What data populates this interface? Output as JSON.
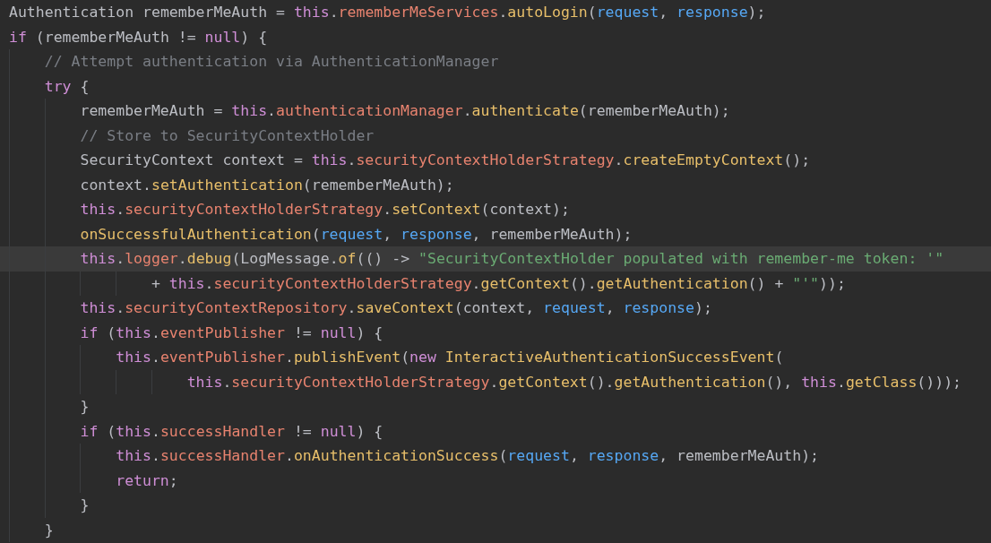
{
  "editor": {
    "lines": [
      {
        "current": false,
        "tokens": [
          {
            "text": "Authentication rememberMeAuth = ",
            "kind": "plain"
          },
          {
            "text": "this",
            "kind": "keyword"
          },
          {
            "text": ".",
            "kind": "plain"
          },
          {
            "text": "rememberMeServices",
            "kind": "field"
          },
          {
            "text": ".",
            "kind": "plain"
          },
          {
            "text": "autoLogin",
            "kind": "method"
          },
          {
            "text": "(",
            "kind": "plain"
          },
          {
            "text": "request",
            "kind": "param"
          },
          {
            "text": ", ",
            "kind": "plain"
          },
          {
            "text": "response",
            "kind": "param"
          },
          {
            "text": ");",
            "kind": "plain"
          }
        ]
      },
      {
        "current": false,
        "tokens": [
          {
            "text": "if",
            "kind": "keyword"
          },
          {
            "text": " (rememberMeAuth != ",
            "kind": "plain"
          },
          {
            "text": "null",
            "kind": "keyword"
          },
          {
            "text": ") {",
            "kind": "plain"
          }
        ]
      },
      {
        "current": false,
        "tokens": [
          {
            "text": "    // Attempt authentication via AuthenticationManager",
            "kind": "comment"
          }
        ]
      },
      {
        "current": false,
        "tokens": [
          {
            "text": "    try",
            "kind": "keyword"
          },
          {
            "text": " {",
            "kind": "plain"
          }
        ]
      },
      {
        "current": false,
        "tokens": [
          {
            "text": "        rememberMeAuth = ",
            "kind": "plain"
          },
          {
            "text": "this",
            "kind": "keyword"
          },
          {
            "text": ".",
            "kind": "plain"
          },
          {
            "text": "authenticationManager",
            "kind": "field"
          },
          {
            "text": ".",
            "kind": "plain"
          },
          {
            "text": "authenticate",
            "kind": "method"
          },
          {
            "text": "(rememberMeAuth);",
            "kind": "plain"
          }
        ]
      },
      {
        "current": false,
        "tokens": [
          {
            "text": "        // Store to SecurityContextHolder",
            "kind": "comment"
          }
        ]
      },
      {
        "current": false,
        "tokens": [
          {
            "text": "        SecurityContext context = ",
            "kind": "plain"
          },
          {
            "text": "this",
            "kind": "keyword"
          },
          {
            "text": ".",
            "kind": "plain"
          },
          {
            "text": "securityContextHolderStrategy",
            "kind": "field"
          },
          {
            "text": ".",
            "kind": "plain"
          },
          {
            "text": "createEmptyContext",
            "kind": "method"
          },
          {
            "text": "();",
            "kind": "plain"
          }
        ]
      },
      {
        "current": false,
        "tokens": [
          {
            "text": "        context.",
            "kind": "plain"
          },
          {
            "text": "setAuthentication",
            "kind": "method"
          },
          {
            "text": "(rememberMeAuth);",
            "kind": "plain"
          }
        ]
      },
      {
        "current": false,
        "tokens": [
          {
            "text": "        this",
            "kind": "keyword"
          },
          {
            "text": ".",
            "kind": "plain"
          },
          {
            "text": "securityContextHolderStrategy",
            "kind": "field"
          },
          {
            "text": ".",
            "kind": "plain"
          },
          {
            "text": "setContext",
            "kind": "method"
          },
          {
            "text": "(context);",
            "kind": "plain"
          }
        ]
      },
      {
        "current": false,
        "tokens": [
          {
            "text": "        onSuccessfulAuthentication",
            "kind": "method"
          },
          {
            "text": "(",
            "kind": "plain"
          },
          {
            "text": "request",
            "kind": "param"
          },
          {
            "text": ", ",
            "kind": "plain"
          },
          {
            "text": "response",
            "kind": "param"
          },
          {
            "text": ", rememberMeAuth);",
            "kind": "plain"
          }
        ]
      },
      {
        "current": true,
        "tokens": [
          {
            "text": "        this",
            "kind": "keyword"
          },
          {
            "text": ".",
            "kind": "plain"
          },
          {
            "text": "logger",
            "kind": "field"
          },
          {
            "text": ".",
            "kind": "plain"
          },
          {
            "text": "debug",
            "kind": "method"
          },
          {
            "text": "(LogMessage.",
            "kind": "plain"
          },
          {
            "text": "of",
            "kind": "method"
          },
          {
            "text": "(() -> ",
            "kind": "plain"
          },
          {
            "text": "\"SecurityContextHolder populated with remember-me token: '\"",
            "kind": "string"
          }
        ]
      },
      {
        "current": false,
        "tokens": [
          {
            "text": "                + ",
            "kind": "plain"
          },
          {
            "text": "this",
            "kind": "keyword"
          },
          {
            "text": ".",
            "kind": "plain"
          },
          {
            "text": "securityContextHolderStrategy",
            "kind": "field"
          },
          {
            "text": ".",
            "kind": "plain"
          },
          {
            "text": "getContext",
            "kind": "method"
          },
          {
            "text": "().",
            "kind": "plain"
          },
          {
            "text": "getAuthentication",
            "kind": "method"
          },
          {
            "text": "() + ",
            "kind": "plain"
          },
          {
            "text": "\"'\"",
            "kind": "string"
          },
          {
            "text": "));",
            "kind": "plain"
          }
        ]
      },
      {
        "current": false,
        "tokens": [
          {
            "text": "        this",
            "kind": "keyword"
          },
          {
            "text": ".",
            "kind": "plain"
          },
          {
            "text": "securityContextRepository",
            "kind": "field"
          },
          {
            "text": ".",
            "kind": "plain"
          },
          {
            "text": "saveContext",
            "kind": "method"
          },
          {
            "text": "(context, ",
            "kind": "plain"
          },
          {
            "text": "request",
            "kind": "param"
          },
          {
            "text": ", ",
            "kind": "plain"
          },
          {
            "text": "response",
            "kind": "param"
          },
          {
            "text": ");",
            "kind": "plain"
          }
        ]
      },
      {
        "current": false,
        "tokens": [
          {
            "text": "        if",
            "kind": "keyword"
          },
          {
            "text": " (",
            "kind": "plain"
          },
          {
            "text": "this",
            "kind": "keyword"
          },
          {
            "text": ".",
            "kind": "plain"
          },
          {
            "text": "eventPublisher",
            "kind": "field"
          },
          {
            "text": " != ",
            "kind": "plain"
          },
          {
            "text": "null",
            "kind": "keyword"
          },
          {
            "text": ") {",
            "kind": "plain"
          }
        ]
      },
      {
        "current": false,
        "tokens": [
          {
            "text": "            this",
            "kind": "keyword"
          },
          {
            "text": ".",
            "kind": "plain"
          },
          {
            "text": "eventPublisher",
            "kind": "field"
          },
          {
            "text": ".",
            "kind": "plain"
          },
          {
            "text": "publishEvent",
            "kind": "method"
          },
          {
            "text": "(",
            "kind": "plain"
          },
          {
            "text": "new",
            "kind": "keyword"
          },
          {
            "text": " InteractiveAuthenticationSuccessEvent",
            "kind": "method"
          },
          {
            "text": "(",
            "kind": "plain"
          }
        ]
      },
      {
        "current": false,
        "tokens": [
          {
            "text": "                    this",
            "kind": "keyword"
          },
          {
            "text": ".",
            "kind": "plain"
          },
          {
            "text": "securityContextHolderStrategy",
            "kind": "field"
          },
          {
            "text": ".",
            "kind": "plain"
          },
          {
            "text": "getContext",
            "kind": "method"
          },
          {
            "text": "().",
            "kind": "plain"
          },
          {
            "text": "getAuthentication",
            "kind": "method"
          },
          {
            "text": "(), ",
            "kind": "plain"
          },
          {
            "text": "this",
            "kind": "keyword"
          },
          {
            "text": ".",
            "kind": "plain"
          },
          {
            "text": "getClass",
            "kind": "method"
          },
          {
            "text": "()));",
            "kind": "plain"
          }
        ]
      },
      {
        "current": false,
        "tokens": [
          {
            "text": "        }",
            "kind": "plain"
          }
        ]
      },
      {
        "current": false,
        "tokens": [
          {
            "text": "        if",
            "kind": "keyword"
          },
          {
            "text": " (",
            "kind": "plain"
          },
          {
            "text": "this",
            "kind": "keyword"
          },
          {
            "text": ".",
            "kind": "plain"
          },
          {
            "text": "successHandler",
            "kind": "field"
          },
          {
            "text": " != ",
            "kind": "plain"
          },
          {
            "text": "null",
            "kind": "keyword"
          },
          {
            "text": ") {",
            "kind": "plain"
          }
        ]
      },
      {
        "current": false,
        "tokens": [
          {
            "text": "            this",
            "kind": "keyword"
          },
          {
            "text": ".",
            "kind": "plain"
          },
          {
            "text": "successHandler",
            "kind": "field"
          },
          {
            "text": ".",
            "kind": "plain"
          },
          {
            "text": "onAuthenticationSuccess",
            "kind": "method"
          },
          {
            "text": "(",
            "kind": "plain"
          },
          {
            "text": "request",
            "kind": "param"
          },
          {
            "text": ", ",
            "kind": "plain"
          },
          {
            "text": "response",
            "kind": "param"
          },
          {
            "text": ", rememberMeAuth);",
            "kind": "plain"
          }
        ]
      },
      {
        "current": false,
        "tokens": [
          {
            "text": "            return",
            "kind": "keyword"
          },
          {
            "text": ";",
            "kind": "plain"
          }
        ]
      },
      {
        "current": false,
        "tokens": [
          {
            "text": "        }",
            "kind": "plain"
          }
        ]
      },
      {
        "current": false,
        "tokens": [
          {
            "text": "    }",
            "kind": "plain"
          }
        ]
      }
    ]
  }
}
